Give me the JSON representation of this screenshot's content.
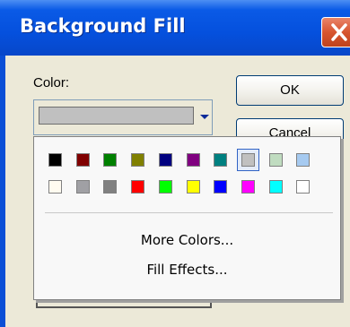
{
  "dialog": {
    "title": "Background Fill",
    "close_icon": "close-icon"
  },
  "color_field": {
    "label": "Color:",
    "selected_color": "#c0c0c0",
    "arrow_icon": "triangle-down-icon"
  },
  "buttons": {
    "ok": "OK",
    "cancel": "Cancel"
  },
  "palette": {
    "row1": [
      "#000000",
      "#800000",
      "#008000",
      "#808000",
      "#000080",
      "#800080",
      "#008080",
      "#c0c0c0",
      "#c0dcc0",
      "#a6caf0"
    ],
    "row2": [
      "#fffbf0",
      "#a0a0a4",
      "#808080",
      "#ff0000",
      "#00ff00",
      "#ffff00",
      "#0000ff",
      "#ff00ff",
      "#00ffff",
      "#ffffff"
    ],
    "selected": "#c0c0c0",
    "more_colors": "More Colors...",
    "fill_effects": "Fill Effects..."
  }
}
